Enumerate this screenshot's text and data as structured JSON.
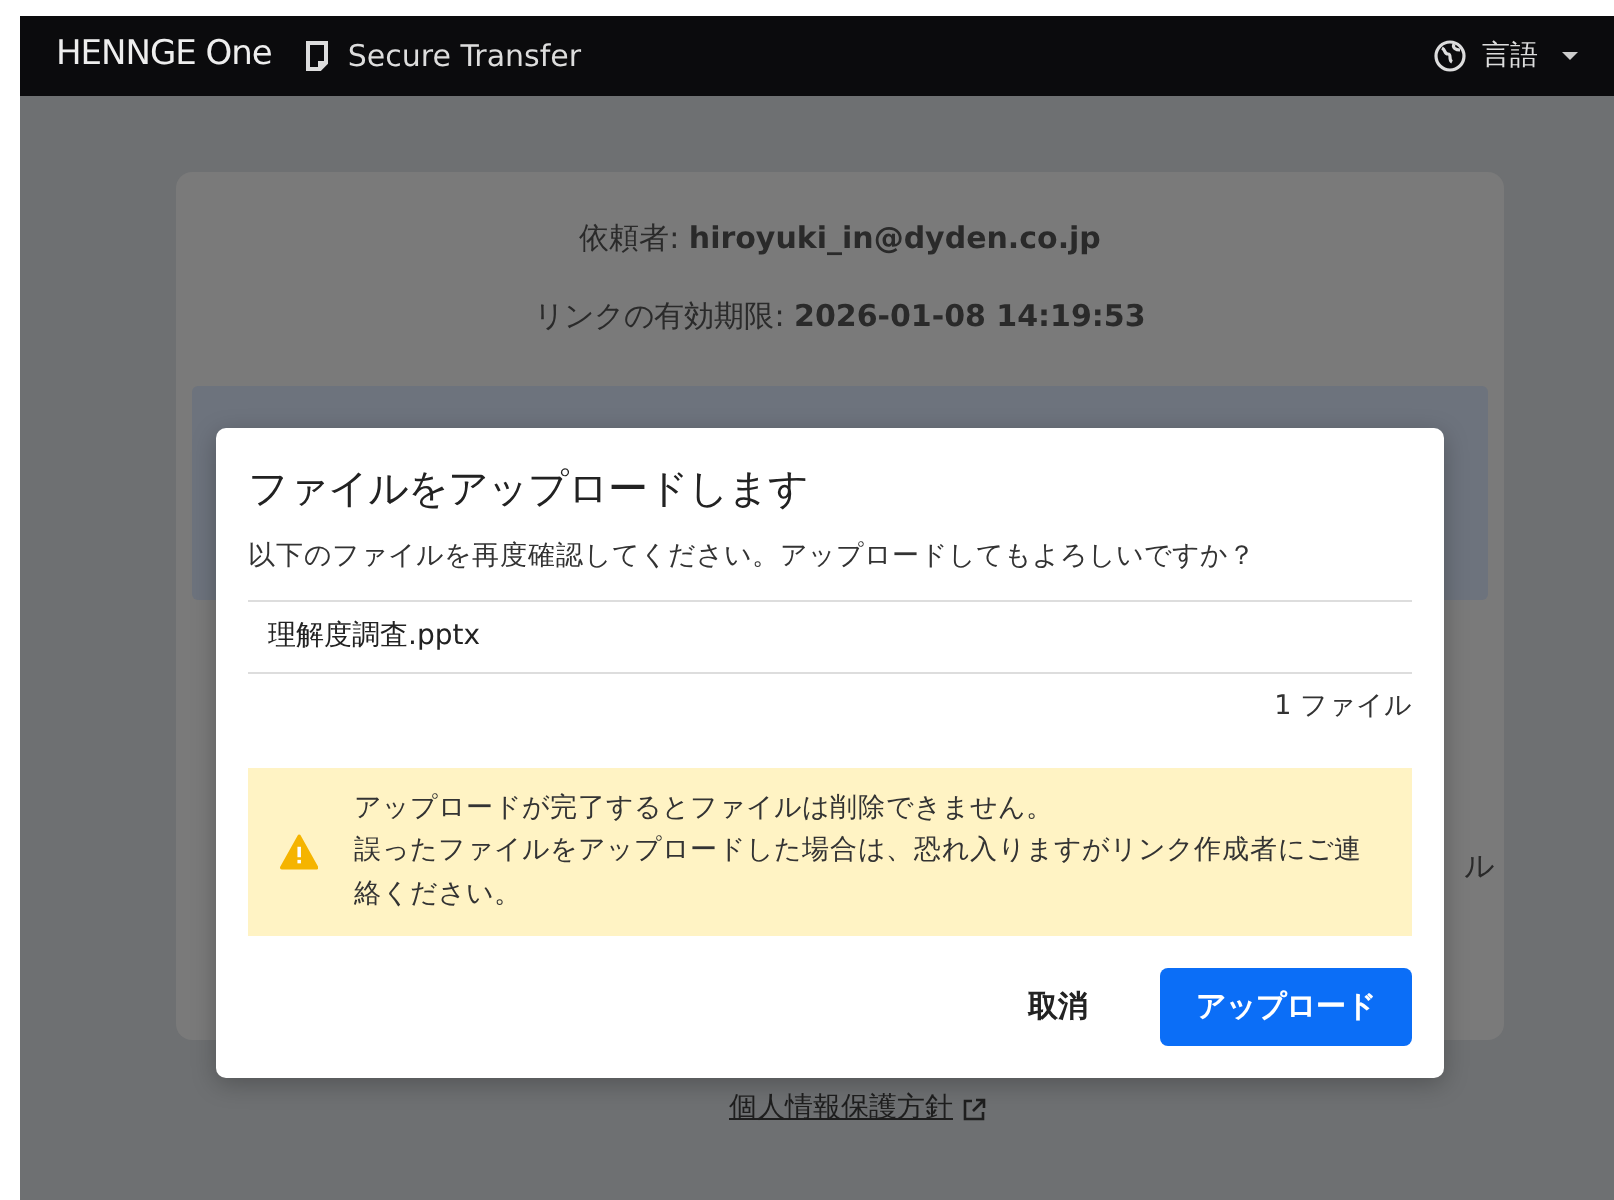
{
  "navbar": {
    "brand": "HENNGE One",
    "product": "Secure Transfer",
    "language_menu": "言語"
  },
  "page": {
    "requester_label": "依頼者:",
    "requester": "hiroyuki_in@dyden.co.jp",
    "expiry_label": "リンクの有効期限:",
    "expiry": "2026-01-08 14:19:53",
    "partial_text": "ル",
    "privacy_link": "個人情報保護方針"
  },
  "modal": {
    "title": "ファイルをアップロードします",
    "message": "以下のファイルを再度確認してください。アップロードしてもよろしいですか？",
    "files": [
      "理解度調査.pptx"
    ],
    "file_count": "1 ファイル",
    "warning": [
      "アップロードが完了するとファイルは削除できません。",
      "誤ったファイルをアップロードした場合は、恐れ入りますがリンク作成者にご連絡ください。"
    ],
    "buttons": [
      {
        "label": "取消",
        "kind": "secondary"
      },
      {
        "label": "アップロード",
        "kind": "primary"
      }
    ]
  }
}
